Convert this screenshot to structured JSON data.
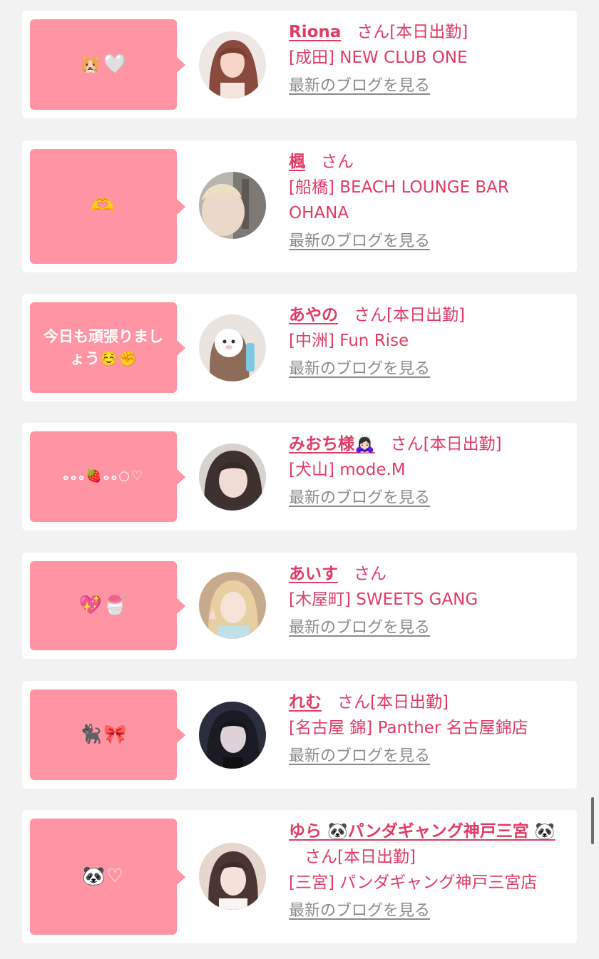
{
  "colors": {
    "page_background": "#f2f2f2",
    "card_background": "#ffffff",
    "bubble": "#ff94a3",
    "accent_text": "#e23b66",
    "blog_link": "#8a8a8a"
  },
  "entries": [
    {
      "bubble_text": "🐹🤍",
      "name": "Riona",
      "san": "さん",
      "status": "[本日出勤]",
      "shop": "[成田] NEW CLUB ONE",
      "blog_link": "最新のブログを見る",
      "avatar": "woman-long-brown-hair-photo"
    },
    {
      "bubble_text": "🫶",
      "name": "楓",
      "san": "さん",
      "status": "",
      "shop": "[船橋] BEACH LOUNGE BAR OHANA",
      "blog_link": "最新のブログを見る",
      "avatar": "blonde-selfie-photo"
    },
    {
      "bubble_text": "今日も頑張りましょう☺️✊",
      "name": "あやの",
      "san": "さん",
      "status": "[本日出勤]",
      "shop": "[中洲] Fun Rise",
      "blog_link": "最新のブログを見る",
      "avatar": "face-hidden-with-sheep-sticker-photo"
    },
    {
      "bubble_text": "ₒₒₒ🍓ₒₒ○♡",
      "name": "みおち様🙇🏻‍♀️",
      "san": "さん",
      "status": "[本日出勤]",
      "shop": "[犬山] mode.M",
      "blog_link": "最新のブログを見る",
      "avatar": "dark-bob-hair-photo"
    },
    {
      "bubble_text": "💖🍧",
      "name": "あいす",
      "san": "さん",
      "status": "",
      "shop": "[木屋町] SWEETS GANG",
      "blog_link": "最新のブログを見る",
      "avatar": "blonde-peace-sign-photo"
    },
    {
      "bubble_text": "🐈‍⬛🎀",
      "name": "れむ",
      "san": "さん",
      "status": "[本日出勤]",
      "shop": "[名古屋 錦] Panther 名古屋錦店",
      "blog_link": "最新のブログを見る",
      "avatar": "dark-hair-dark-photo"
    },
    {
      "bubble_text": "🐼♡",
      "name": "ゆら 🐼パンダギャング神戸三宮 🐼",
      "san": "さん",
      "status": "[本日出勤]",
      "shop": "[三宮] パンダギャング神戸三宮店",
      "blog_link": "最新のブログを見る",
      "avatar": "dark-hair-light-top-photo"
    }
  ]
}
